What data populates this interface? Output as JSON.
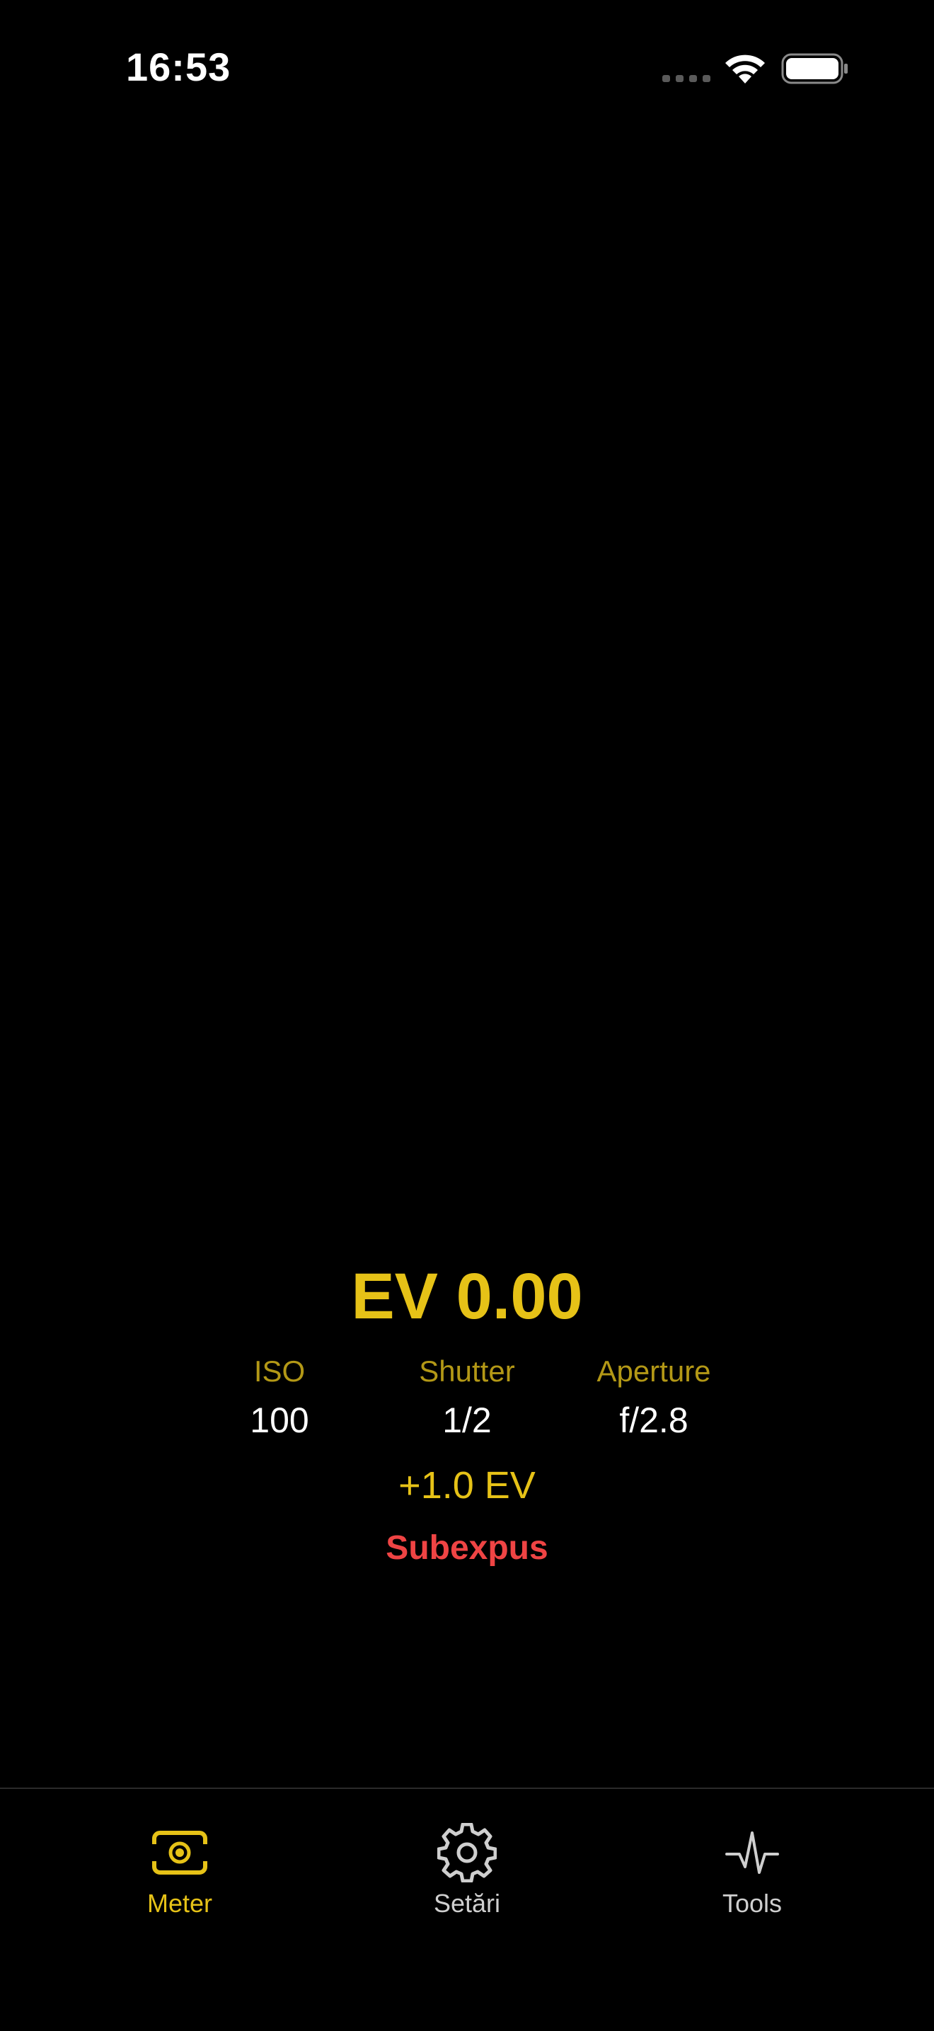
{
  "status_bar": {
    "time": "16:53"
  },
  "meter": {
    "ev_reading": "EV 0.00",
    "params": [
      {
        "label": "ISO",
        "value": "100"
      },
      {
        "label": "Shutter",
        "value": "1/2"
      },
      {
        "label": "Aperture",
        "value": "f/2.8"
      }
    ],
    "compensation": "+1.0 EV",
    "exposure_status": "Subexpus"
  },
  "tab_bar": {
    "tabs": [
      {
        "label": "Meter",
        "icon": "camera-meter-icon",
        "active": true
      },
      {
        "label": "Setări",
        "icon": "gear-icon",
        "active": false
      },
      {
        "label": "Tools",
        "icon": "waveform-icon",
        "active": false
      }
    ]
  },
  "colors": {
    "accent": "#e6c217",
    "label_dim": "#b39816",
    "warning": "#ef4444",
    "background": "#000000"
  }
}
